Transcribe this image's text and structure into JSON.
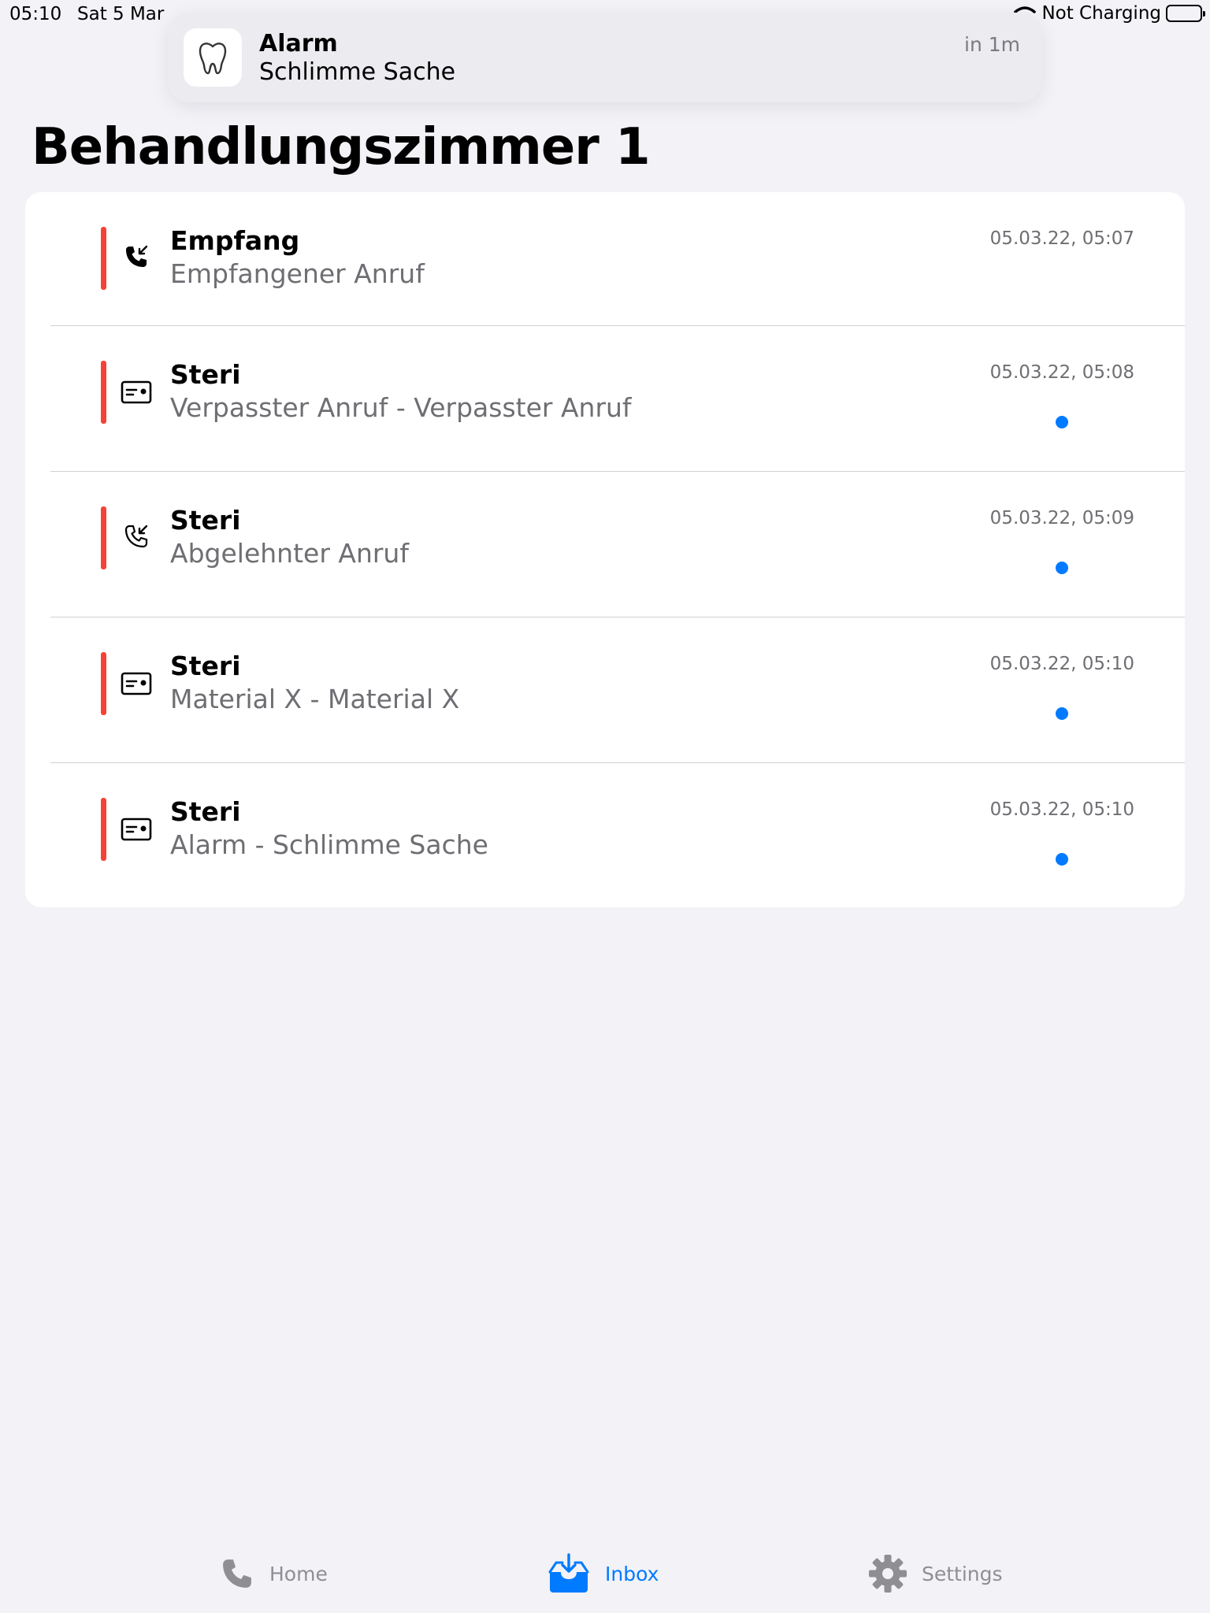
{
  "status_bar": {
    "time": "05:10",
    "date": "Sat 5 Mar",
    "charging": "Not Charging",
    "icons": [
      "wifi-icon",
      "battery-icon"
    ]
  },
  "notification": {
    "icon": "tooth-icon",
    "title": "Alarm",
    "body": "Schlimme Sache",
    "time": "in 1m"
  },
  "page": {
    "title": "Behandlungszimmer 1"
  },
  "inbox": {
    "items": [
      {
        "icon": "incoming-call-icon",
        "title": "Empfang",
        "subtitle": "Empfangener Anruf",
        "time": "05.03.22, 05:07",
        "unread": false
      },
      {
        "icon": "message-card-icon",
        "title": "Steri",
        "subtitle": "Verpasster Anruf - Verpasster Anruf",
        "time": "05.03.22, 05:08",
        "unread": true
      },
      {
        "icon": "declined-call-icon",
        "title": "Steri",
        "subtitle": "Abgelehnter Anruf",
        "time": "05.03.22, 05:09",
        "unread": true
      },
      {
        "icon": "message-card-icon",
        "title": "Steri",
        "subtitle": "Material X - Material X",
        "time": "05.03.22, 05:10",
        "unread": true
      },
      {
        "icon": "message-card-icon",
        "title": "Steri",
        "subtitle": "Alarm - Schlimme Sache",
        "time": "05.03.22, 05:10",
        "unread": true
      }
    ]
  },
  "tab_bar": {
    "tabs": [
      {
        "icon": "phone-icon",
        "label": "Home",
        "active": false
      },
      {
        "icon": "inbox-icon",
        "label": "Inbox",
        "active": true
      },
      {
        "icon": "gear-icon",
        "label": "Settings",
        "active": false
      }
    ]
  },
  "colors": {
    "accent": "#007aff",
    "priority_bar": "#f44336",
    "background": "#f2f2f7",
    "secondary_text": "#6e6e73",
    "inactive_tab": "#8e8e93"
  }
}
